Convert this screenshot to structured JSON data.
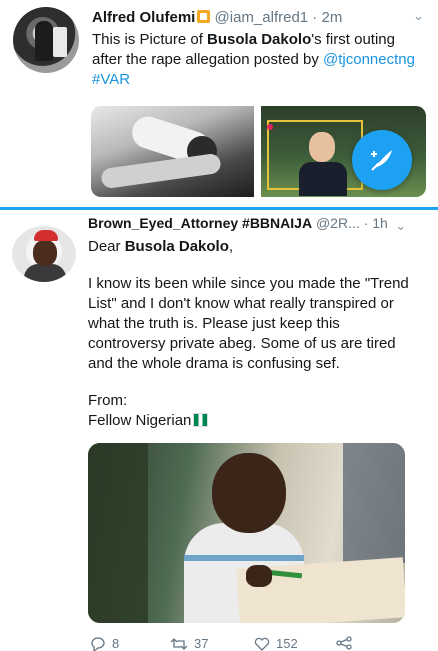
{
  "tweet1": {
    "name": "Alfred Olufemi",
    "handle": "@iam_alfred1",
    "sep": " · ",
    "time": "2m",
    "text_a": "This is Picture of ",
    "text_b": "Busola Dakolo",
    "text_c": "'s first outing after the rape allegation posted by ",
    "mention": "@tjconnectng",
    "hashtag": "#VAR",
    "chevron": "⌄",
    "fab_icon": "compose-feather-icon"
  },
  "tweet2": {
    "name": "Brown_Eyed_Attorney #BBNAIJA",
    "handle": "@2R...",
    "sep": " · ",
    "time": "1h",
    "chevron": "⌄",
    "greeting_a": "Dear ",
    "greeting_b": "Busola Dakolo",
    "greeting_c": ",",
    "body": "I know its been while since you made the \"Trend List\" and I don't know what really transpired or what the truth is. Please just keep this controversy private abeg. Some of us are tired and the whole drama is confusing sef.",
    "from_label": "From:",
    "signoff": "Fellow Nigerian",
    "flag_icon": "nigeria-flag-icon",
    "actions": {
      "replies": "8",
      "retweets": "37",
      "likes": "152"
    }
  },
  "colors": {
    "accent": "#1da1f2",
    "link": "#1b95e0",
    "muted": "#657786"
  }
}
